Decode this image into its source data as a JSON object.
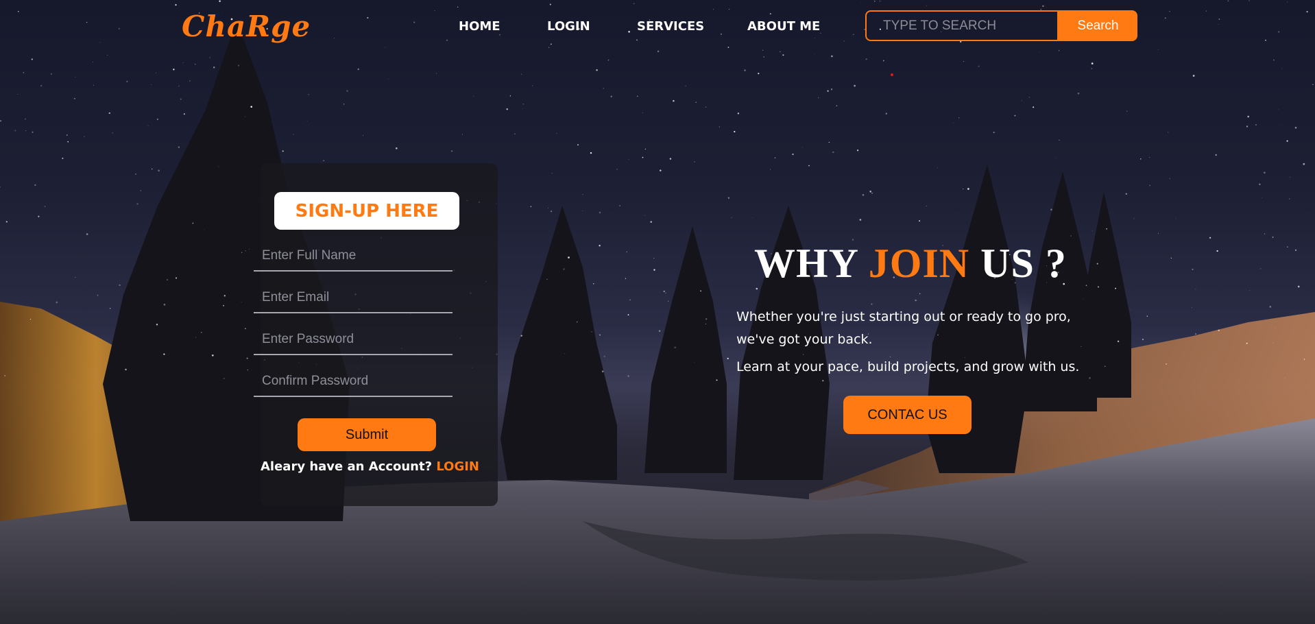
{
  "brand": {
    "logo": "ChaRge"
  },
  "nav": {
    "items": [
      "HOME",
      "LOGIN",
      "SERVICES",
      "ABOUT ME"
    ]
  },
  "search": {
    "placeholder": "TYPE TO SEARCH",
    "button_label": "Search"
  },
  "signup": {
    "title": "SIGN-UP HERE",
    "fields": {
      "full_name_placeholder": "Enter Full Name",
      "email_placeholder": "Enter Email",
      "password_placeholder": "Enter Password",
      "confirm_password_placeholder": "Confirm Password"
    },
    "submit_label": "Submit",
    "account_prompt": "Aleary have an Account?",
    "login_link": "LOGIN"
  },
  "why_join": {
    "title_part1": "WHY",
    "title_accent": "JOIN",
    "title_part2": "US ?",
    "line1": "Whether you're just starting out or ready to go pro, we've got your back.",
    "line2": "Learn at your pace, build projects, and grow with us.",
    "button_label": "CONTAC US"
  },
  "colors": {
    "accent": "#ff7a12",
    "text": "#ffffff"
  }
}
